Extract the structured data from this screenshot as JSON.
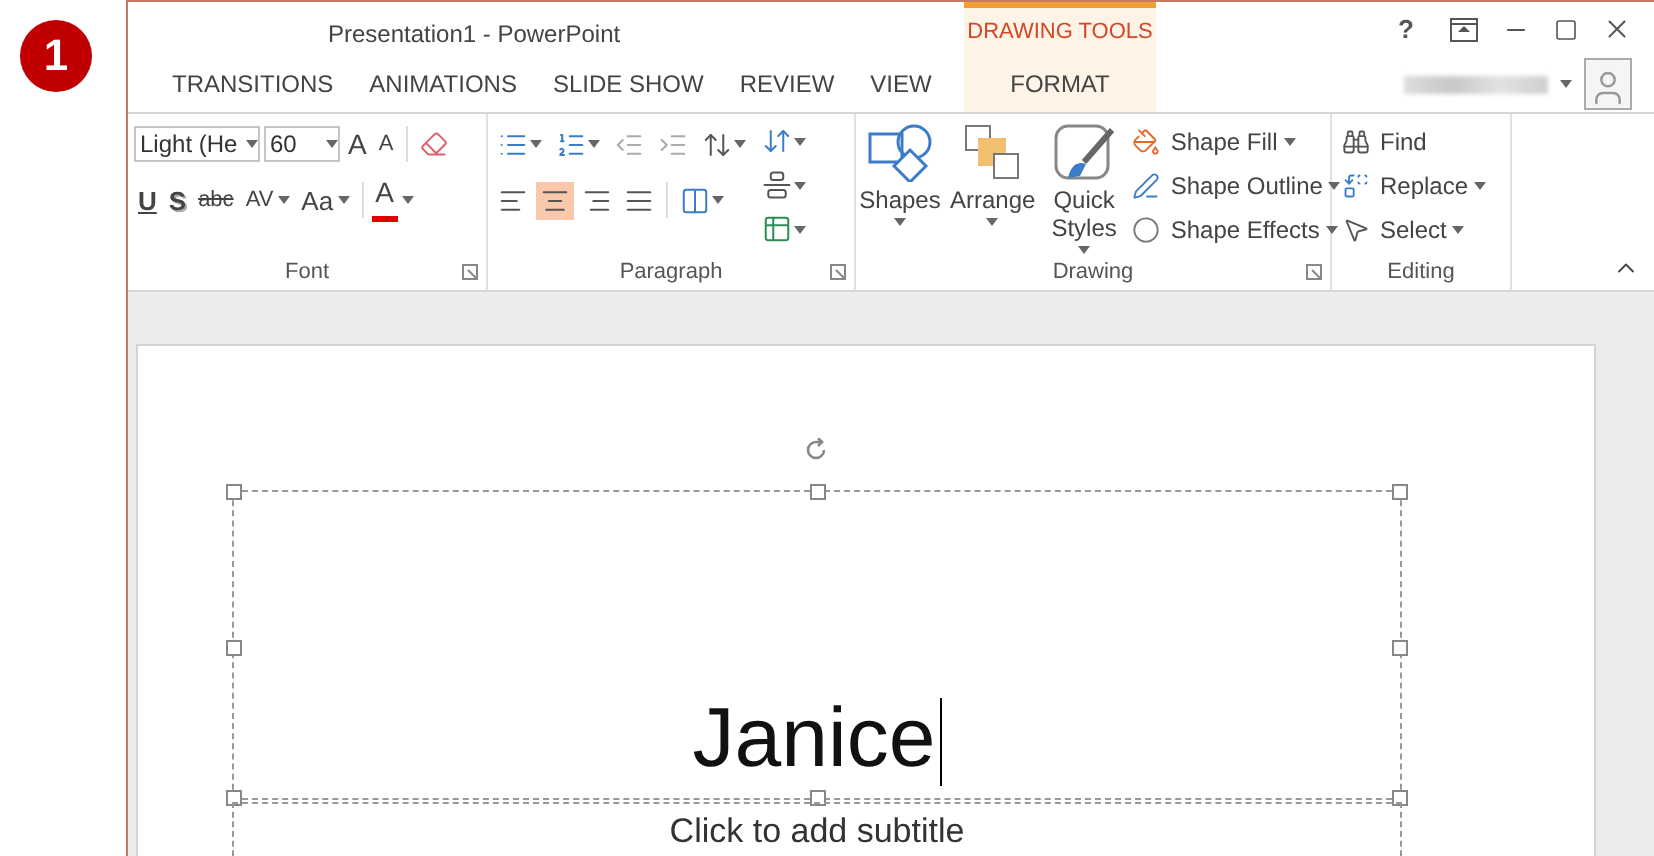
{
  "badge": "1",
  "window": {
    "title": "Presentation1 - PowerPoint",
    "context_group": "DRAWING TOOLS",
    "help": "?"
  },
  "tabs": [
    {
      "label": "TRANSITIONS",
      "kind": "standard"
    },
    {
      "label": "ANIMATIONS",
      "kind": "standard"
    },
    {
      "label": "SLIDE SHOW",
      "kind": "standard"
    },
    {
      "label": "REVIEW",
      "kind": "standard"
    },
    {
      "label": "VIEW",
      "kind": "standard"
    },
    {
      "label": "FORMAT",
      "kind": "contextual"
    }
  ],
  "ribbon": {
    "font": {
      "label": "Font",
      "font_name": "Light (He",
      "font_size": "60",
      "grow": "A",
      "shrink": "A",
      "underline": "U",
      "shadow": "S",
      "strikethrough": "abc",
      "spacing": "AV",
      "change_case": "Aa",
      "font_color": "A"
    },
    "paragraph": {
      "label": "Paragraph",
      "alignments": [
        {
          "kind": "left",
          "selected": false
        },
        {
          "kind": "center",
          "selected": true
        },
        {
          "kind": "right",
          "selected": false
        },
        {
          "kind": "justify",
          "selected": false
        }
      ]
    },
    "drawing": {
      "label": "Drawing",
      "large_buttons": [
        {
          "label": "Shapes",
          "kind": "shapes"
        },
        {
          "label": "Arrange",
          "kind": "arrange"
        },
        {
          "label": "Quick Styles",
          "kind": "styles"
        }
      ],
      "small_buttons": [
        {
          "label": "Shape Fill",
          "kind": "fill",
          "dropdown": true
        },
        {
          "label": "Shape Outline",
          "kind": "outline",
          "dropdown": true
        },
        {
          "label": "Shape Effects",
          "kind": "effects",
          "dropdown": true
        }
      ]
    },
    "editing": {
      "label": "Editing",
      "buttons": [
        {
          "label": "Find",
          "kind": "find",
          "dropdown": false
        },
        {
          "label": "Replace",
          "kind": "replace",
          "dropdown": true
        },
        {
          "label": "Select",
          "kind": "select",
          "dropdown": true
        }
      ]
    }
  },
  "slide": {
    "title": "Janice",
    "subtitle_placeholder": "Click to add subtitle"
  }
}
